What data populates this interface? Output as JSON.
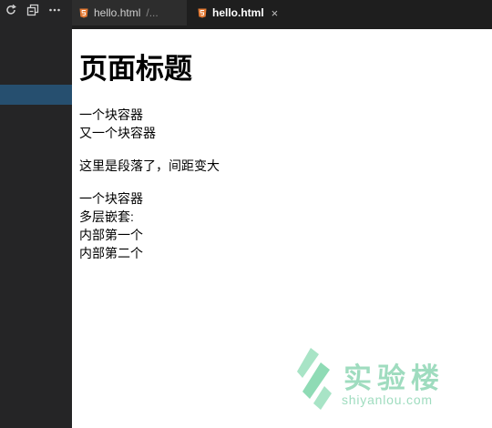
{
  "sidebar": {
    "toolbar": [
      {
        "icon": "refresh-icon",
        "glyph": "↻"
      },
      {
        "icon": "collapse-all-icon",
        "glyph": "⧉"
      },
      {
        "icon": "more-icon",
        "glyph": "•••"
      }
    ]
  },
  "tabs": [
    {
      "label": "hello.html",
      "path": "/...",
      "icon": "html5-icon",
      "active": false
    },
    {
      "label": "hello.html",
      "close": "×",
      "icon": "html5-icon",
      "active": true
    }
  ],
  "preview": {
    "title": "页面标题",
    "block1": "一个块容器",
    "block2": "又一个块容器",
    "paragraph": "这里是段落了，间距变大",
    "block3": "一个块容器",
    "nested": "多层嵌套:",
    "inner1": "内部第一个",
    "inner2": "内部第二个"
  },
  "watermark": {
    "title": "实验楼",
    "url": "shiyanlou.com",
    "color": "#9fdcbf"
  },
  "colors": {
    "sidebar_bg": "#252526",
    "sidebar_selected": "#264f6f",
    "tab_active_bg": "#1e1e1e",
    "tab_inactive_bg": "#2d2d2d",
    "html_icon": "#e37933"
  }
}
